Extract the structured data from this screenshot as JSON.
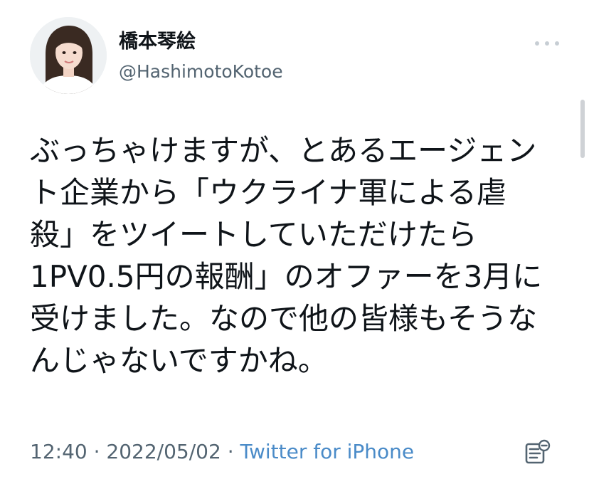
{
  "author": {
    "display_name": "橋本琴絵",
    "handle": "@HashimotoKotoe"
  },
  "tweet": {
    "lines": [
      "ぶっちゃけますが、とあるエージェン",
      "ト企業から「ウクライナ軍による虐",
      "殺」をツイートしていただけたら",
      "1PV0.5円の報酬」のオファーを3月に",
      "受けました。なので他の皆様もそうな",
      "んじゃないですかね。"
    ]
  },
  "meta": {
    "time": "12:40",
    "separator": " · ",
    "date": "2022/05/02",
    "source": "Twitter for iPhone"
  },
  "icons": {
    "avatar": "avatar-photo",
    "more": "more-horizontal-icon",
    "analytics": "tweet-analytics-icon"
  },
  "colors": {
    "text": "#0f1419",
    "secondary": "#536471",
    "link": "#4a8bc8"
  }
}
